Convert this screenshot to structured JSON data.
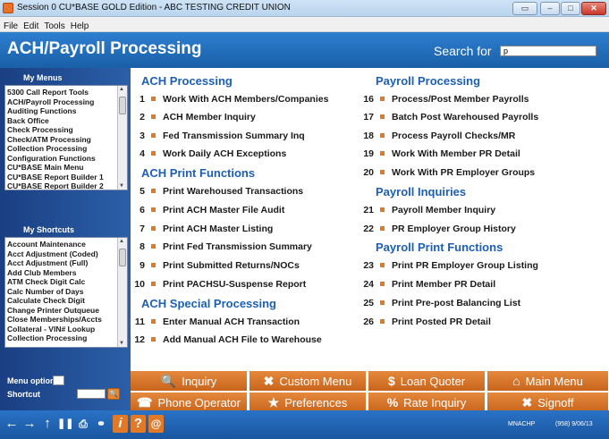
{
  "window": {
    "title": "Session 0 CU*BASE GOLD Edition - ABC TESTING CREDIT UNION",
    "menus": [
      "File",
      "Edit",
      "Tools",
      "Help"
    ]
  },
  "header": {
    "title": "ACH/Payroll Processing",
    "search_label": "Search for",
    "search_value": "p"
  },
  "sidebar": {
    "my_menus_label": "My Menus",
    "my_menus": [
      "5300 Call Report Tools",
      "ACH/Payroll Processing",
      "Auditing Functions",
      "Back Office",
      "Check Processing",
      "Check/ATM Processing",
      "Collection Processing",
      "Configuration Functions",
      "CU*BASE Main Menu",
      "CU*BASE Report Builder 1",
      "CU*BASE Report Builder 2"
    ],
    "my_shortcuts_label": "My Shortcuts",
    "my_shortcuts": [
      "Account Maintenance",
      "Acct Adjustment (Coded)",
      "Acct Adjustment (Full)",
      "Add Club Members",
      "ATM Check Digit Calc",
      "Calc Number of Days",
      "Calculate Check Digit",
      "Change Printer Outqueue",
      "Close Memberships/Accts",
      "Collateral - VIN# Lookup",
      "Collection Processing"
    ],
    "menu_option_label": "Menu option",
    "shortcut_label": "Shortcut"
  },
  "sections": {
    "ach_processing": {
      "title": "ACH Processing",
      "items": [
        {
          "num": "1",
          "label": "Work With ACH Members/Companies"
        },
        {
          "num": "2",
          "label": "ACH Member Inquiry"
        },
        {
          "num": "3",
          "label": "Fed Transmission Summary Inq"
        },
        {
          "num": "4",
          "label": "Work Daily ACH Exceptions"
        }
      ]
    },
    "ach_print": {
      "title": "ACH Print Functions",
      "items": [
        {
          "num": "5",
          "label": "Print Warehoused Transactions"
        },
        {
          "num": "6",
          "label": "Print ACH Master File Audit"
        },
        {
          "num": "7",
          "label": "Print ACH Master Listing"
        },
        {
          "num": "8",
          "label": "Print Fed Transmission Summary"
        },
        {
          "num": "9",
          "label": "Print Submitted Returns/NOCs"
        },
        {
          "num": "10",
          "label": "Print PACHSU-Suspense Report"
        }
      ]
    },
    "ach_special": {
      "title": "ACH Special Processing",
      "items": [
        {
          "num": "11",
          "label": "Enter Manual ACH Transaction"
        },
        {
          "num": "12",
          "label": "Add Manual ACH File to Warehouse"
        }
      ]
    },
    "payroll_processing": {
      "title": "Payroll Processing",
      "items": [
        {
          "num": "16",
          "label": "Process/Post Member Payrolls"
        },
        {
          "num": "17",
          "label": "Batch Post Warehoused Payrolls"
        },
        {
          "num": "18",
          "label": "Process Payroll Checks/MR"
        },
        {
          "num": "19",
          "label": "Work With Member PR Detail"
        },
        {
          "num": "20",
          "label": "Work With PR Employer Groups"
        }
      ]
    },
    "payroll_inquiries": {
      "title": "Payroll Inquiries",
      "items": [
        {
          "num": "21",
          "label": "Payroll Member Inquiry"
        },
        {
          "num": "22",
          "label": "PR Employer Group History"
        }
      ]
    },
    "payroll_print": {
      "title": "Payroll Print Functions",
      "items": [
        {
          "num": "23",
          "label": "Print PR Employer Group Listing"
        },
        {
          "num": "24",
          "label": "Print Member PR Detail"
        },
        {
          "num": "25",
          "label": "Print Pre-post Balancing List"
        },
        {
          "num": "26",
          "label": "Print Posted PR Detail"
        }
      ]
    }
  },
  "buttons": [
    {
      "label": "Inquiry",
      "icon": "magnifier-icon"
    },
    {
      "label": "Custom Menu",
      "icon": "tools-icon"
    },
    {
      "label": "Loan Quoter",
      "icon": "money-bag-icon"
    },
    {
      "label": "Main Menu",
      "icon": "home-icon"
    },
    {
      "label": "Phone Operator",
      "icon": "phone-icon"
    },
    {
      "label": "Preferences",
      "icon": "star-icon"
    },
    {
      "label": "Rate Inquiry",
      "icon": "percent-icon"
    },
    {
      "label": "Signoff",
      "icon": "x-icon"
    }
  ],
  "status": {
    "screen_code": "MNACHP",
    "date": "(958) 9/06/13"
  },
  "colors": {
    "accent_blue": "#1c5fb4",
    "orange": "#e07a2a"
  }
}
